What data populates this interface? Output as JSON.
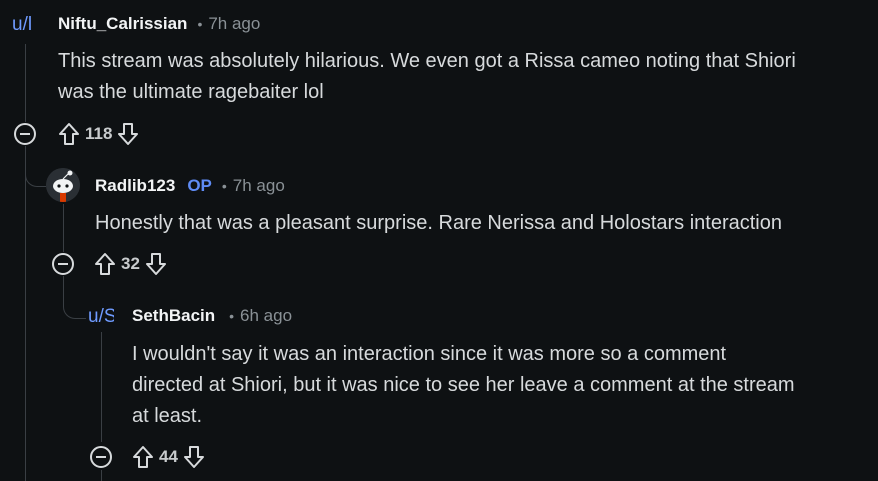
{
  "comments": [
    {
      "avatar_text": "u/l",
      "author": "Niftu_Calrissian",
      "op": "",
      "time": "7h ago",
      "lines": [
        "This stream was absolutely hilarious. We even got a Rissa cameo noting that Shiori",
        "was the ultimate ragebaiter lol"
      ],
      "votes": "118"
    },
    {
      "avatar_text": "",
      "author": "Radlib123",
      "op": "OP",
      "time": "7h ago",
      "lines": [
        "Honestly that was a pleasant surprise. Rare Nerissa and Holostars interaction"
      ],
      "votes": "32"
    },
    {
      "avatar_text": "u/S",
      "author": "SethBacin",
      "op": "",
      "time": "6h ago",
      "lines": [
        "I wouldn't say it was an interaction since it was more so a comment",
        "directed at Shiori, but it was nice to see her leave a comment at the stream",
        "at least."
      ],
      "votes": "44"
    }
  ],
  "dot_separator": "•",
  "colors": {
    "background": "#0e1113",
    "op_badge": "#5f8cf5",
    "avatar_link": "#6f9bff",
    "thread_line": "#3a3f44"
  }
}
